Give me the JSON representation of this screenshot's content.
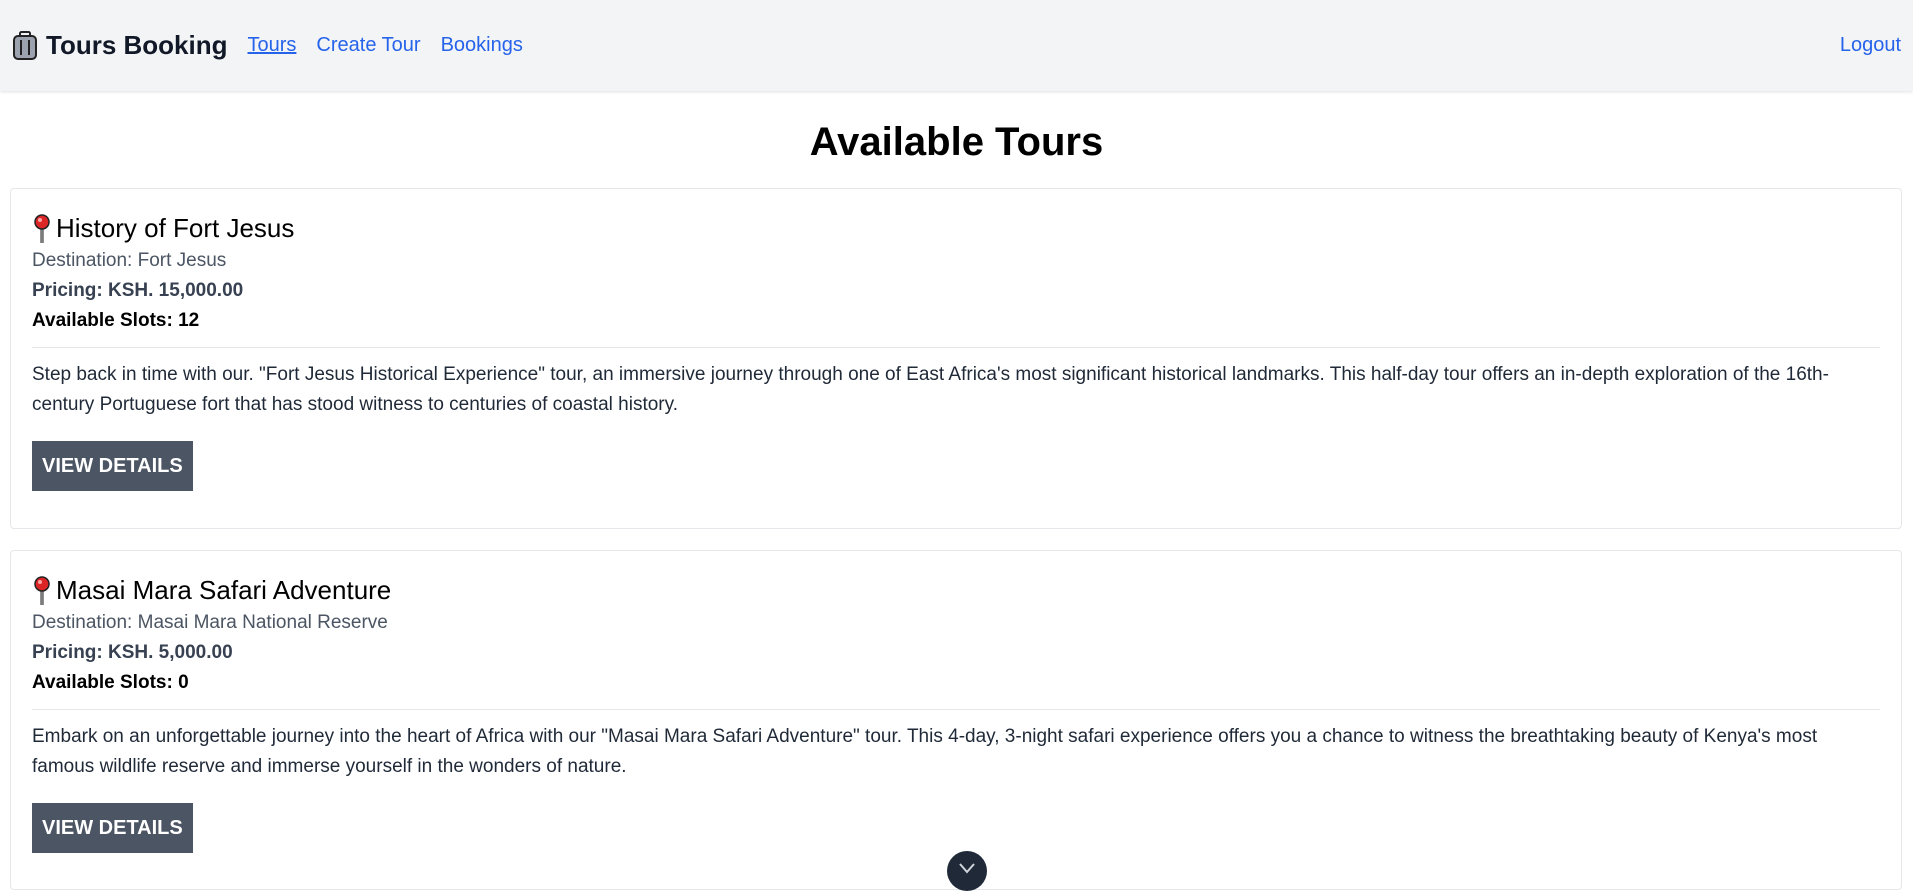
{
  "navbar": {
    "brand_icon": "luggage-icon",
    "brand_name": "Tours Booking",
    "links": [
      {
        "label": "Tours",
        "active": true
      },
      {
        "label": "Create Tour",
        "active": false
      },
      {
        "label": "Bookings",
        "active": false
      }
    ],
    "logout_label": "Logout"
  },
  "page": {
    "title": "Available Tours"
  },
  "tours": [
    {
      "icon": "map-pin-icon",
      "name": "History of Fort Jesus",
      "destination": "Destination: Fort Jesus",
      "pricing": "Pricing: KSH. 15,000.00",
      "slots": "Available Slots: 12",
      "description": "Step back in time with our. \"Fort Jesus Historical Experience\" tour, an immersive journey through one of East Africa's most significant historical landmarks. This half-day tour offers an in-depth exploration of the 16th-century Portuguese fort that has stood witness to centuries of coastal history.",
      "button_label": "VIEW DETAILS"
    },
    {
      "icon": "map-pin-icon",
      "name": "Masai Mara Safari Adventure",
      "destination": "Destination: Masai Mara National Reserve",
      "pricing": "Pricing: KSH. 5,000.00",
      "slots": "Available Slots: 0",
      "description": "Embark on an unforgettable journey into the heart of Africa with our \"Masai Mara Safari Adventure\" tour. This 4-day, 3-night safari experience offers you a chance to witness the breathtaking beauty of Kenya's most famous wildlife reserve and immerse yourself in the wonders of nature.",
      "button_label": "VIEW DETAILS"
    }
  ],
  "scroll_down_icon": "chevron-down-icon",
  "colors": {
    "link": "#2563eb",
    "button_bg": "#4b5563",
    "navbar_bg": "#f3f4f6",
    "pin": "#dc2626"
  }
}
